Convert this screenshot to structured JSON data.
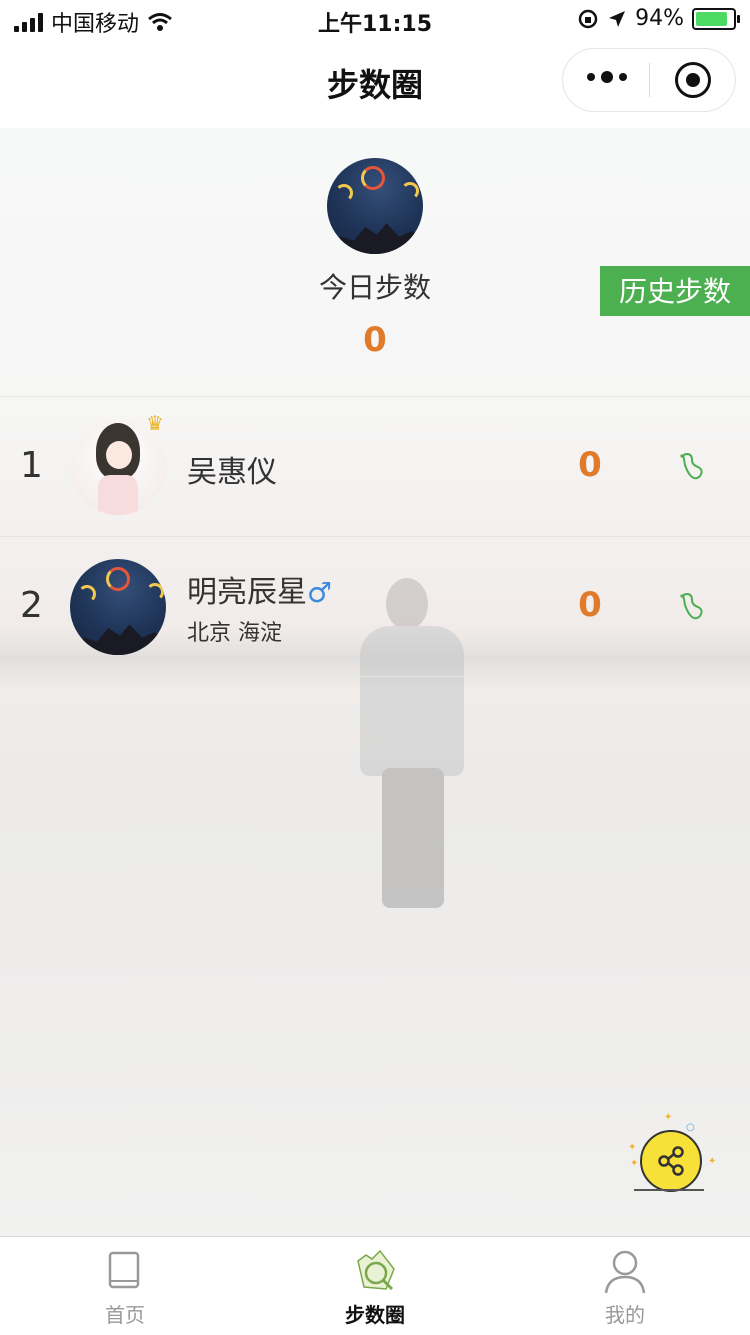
{
  "status_bar": {
    "carrier": "中国移动",
    "time": "上午11:15",
    "battery_percent": "94%"
  },
  "nav": {
    "title": "步数圈"
  },
  "header": {
    "today_label": "今日步数",
    "today_steps": "0",
    "history_button": "历史步数"
  },
  "ranking": [
    {
      "rank": "1",
      "name": "吴惠仪",
      "gender": "",
      "location": "",
      "steps": "0",
      "top_rank_badge": "crown-icon"
    },
    {
      "rank": "2",
      "name": "明亮辰星",
      "gender": "♂",
      "location": "北京 海淀",
      "steps": "0"
    }
  ],
  "tabs": [
    {
      "label": "首页",
      "icon": "book-icon",
      "active": false
    },
    {
      "label": "步数圈",
      "icon": "step-circle-icon",
      "active": true
    },
    {
      "label": "我的",
      "icon": "user-icon",
      "active": false
    }
  ],
  "colors": {
    "accent_green": "#4caf50",
    "steps_orange": "#e07b2c",
    "share_yellow": "#f7e037",
    "gender_blue": "#3a8be0"
  }
}
